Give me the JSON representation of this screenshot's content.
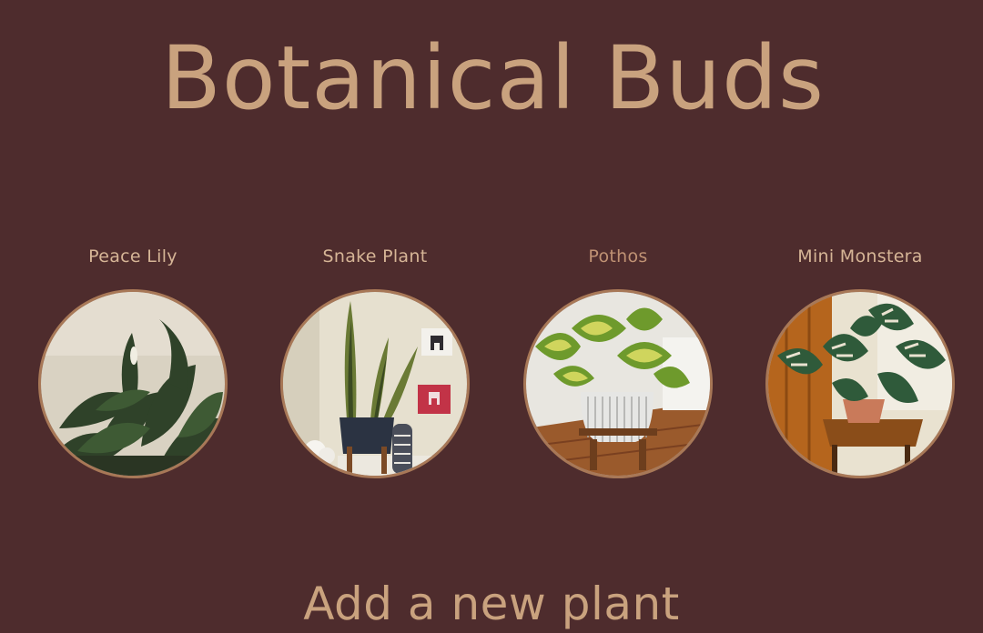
{
  "site": {
    "title": "Botanical Buds"
  },
  "plants": [
    {
      "name": "Peace Lily"
    },
    {
      "name": "Snake Plant"
    },
    {
      "name": "Pothos"
    },
    {
      "name": "Mini Monstera"
    }
  ],
  "add_section": {
    "heading": "Add a new plant"
  },
  "colors": {
    "background": "#4e2c2d",
    "title": "#c9a27e",
    "plant_name": "#d6b596",
    "plant_name_hover": "#c09274",
    "photo_border": "#a87857"
  }
}
